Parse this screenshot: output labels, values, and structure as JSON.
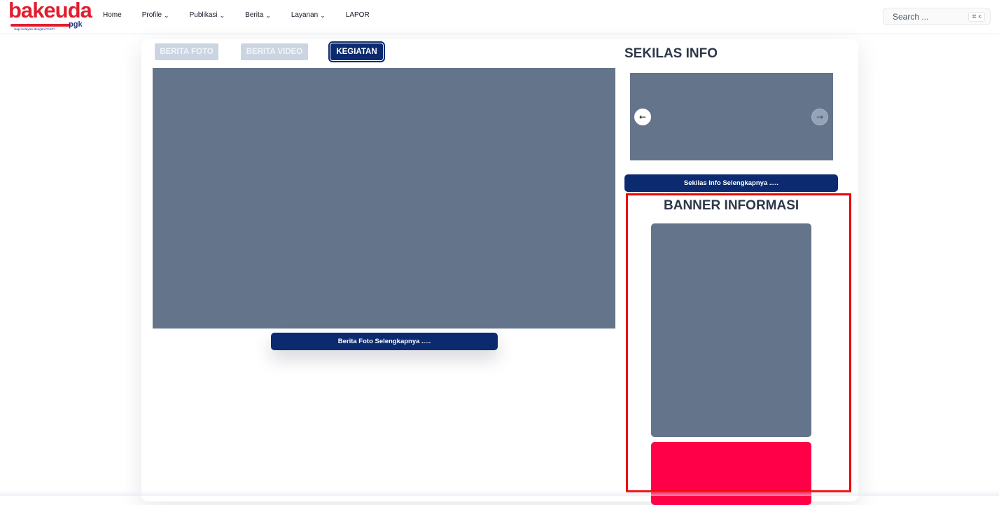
{
  "logo": {
    "brand_red": "ba",
    "brand_blue": "keuda",
    "suffix": "pgk",
    "tagline": "siap melayani dengan PASTI"
  },
  "nav": {
    "items": [
      {
        "label": "Home",
        "has_dropdown": false
      },
      {
        "label": "Profile",
        "has_dropdown": true
      },
      {
        "label": "Publikasi",
        "has_dropdown": true
      },
      {
        "label": "Berita",
        "has_dropdown": true
      },
      {
        "label": "Layanan",
        "has_dropdown": true
      },
      {
        "label": "LAPOR",
        "has_dropdown": false
      }
    ],
    "chevron": "⌄"
  },
  "search": {
    "placeholder": "Search ...",
    "shortcut": "⌘ K"
  },
  "tabs": [
    {
      "label": "BERITA FOTO",
      "active": false
    },
    {
      "label": "BERITA VIDEO",
      "active": false
    },
    {
      "label": "KEGIATAN",
      "active": true
    }
  ],
  "main": {
    "more_button": "Berita Foto Selengkapnya ....."
  },
  "sidebar": {
    "info_title": "SEKILAS INFO",
    "info_more_button": "Sekilas Info Selengkapnya .....",
    "prev_arrow": "←",
    "next_arrow": "→",
    "banner_title": "BANNER INFORMASI"
  },
  "colors": {
    "brand_blue": "#0b2a6f",
    "brand_red": "#e11d2e",
    "placeholder_gray": "#64748b",
    "banner_pink": "#ff0048",
    "highlight_red": "#ef0000"
  }
}
